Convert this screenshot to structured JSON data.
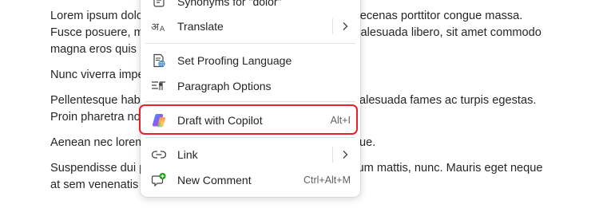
{
  "document": {
    "paragraphs": [
      "Lorem ipsum dolor sit amet, consectetuer adipiscing elit. Maecenas porttitor congue massa. Fusce posuere, magna sed pulvinar ultricies, purus lectus malesuada libero, sit amet commodo magna eros quis urna.",
      "Nunc viverra imperdiet enim. Fusce est. Vivamus a tellus.",
      "Pellentesque habitant morbi tristique senectus et netus et malesuada fames ac turpis egestas. Proin pharetra nonummy pede. Mauris et orci.",
      "Aenean nec lorem. In porttitor. Donec laoreet nonummy augue.",
      "Suspendisse dui purus, scelerisque at, vulputate vitae, pretium mattis, nunc. Mauris eget neque at sem venenatis eleifend. Ut nonummy."
    ]
  },
  "menu": {
    "items": [
      {
        "label": "Synonyms for \"dolor\"",
        "icon": "synonyms-icon"
      },
      {
        "label": "Translate",
        "icon": "translate-icon",
        "submenu": true
      },
      {
        "label": "Set Proofing Language",
        "icon": "proofing-language-icon"
      },
      {
        "label": "Paragraph Options",
        "icon": "paragraph-options-icon"
      },
      {
        "label": "Draft with Copilot",
        "icon": "copilot-icon",
        "shortcut": "Alt+I",
        "highlighted": true
      },
      {
        "label": "Link",
        "icon": "link-icon",
        "submenu": true
      },
      {
        "label": "New Comment",
        "icon": "new-comment-icon",
        "shortcut": "Ctrl+Alt+M"
      }
    ]
  },
  "colors": {
    "highlight_border": "#e8202a",
    "copilot_gradient": [
      "#2ea8ff",
      "#8b5cf6",
      "#ff6a3d",
      "#ffc83d",
      "#3ccf7a"
    ],
    "comment_badge": "#13a10e"
  }
}
